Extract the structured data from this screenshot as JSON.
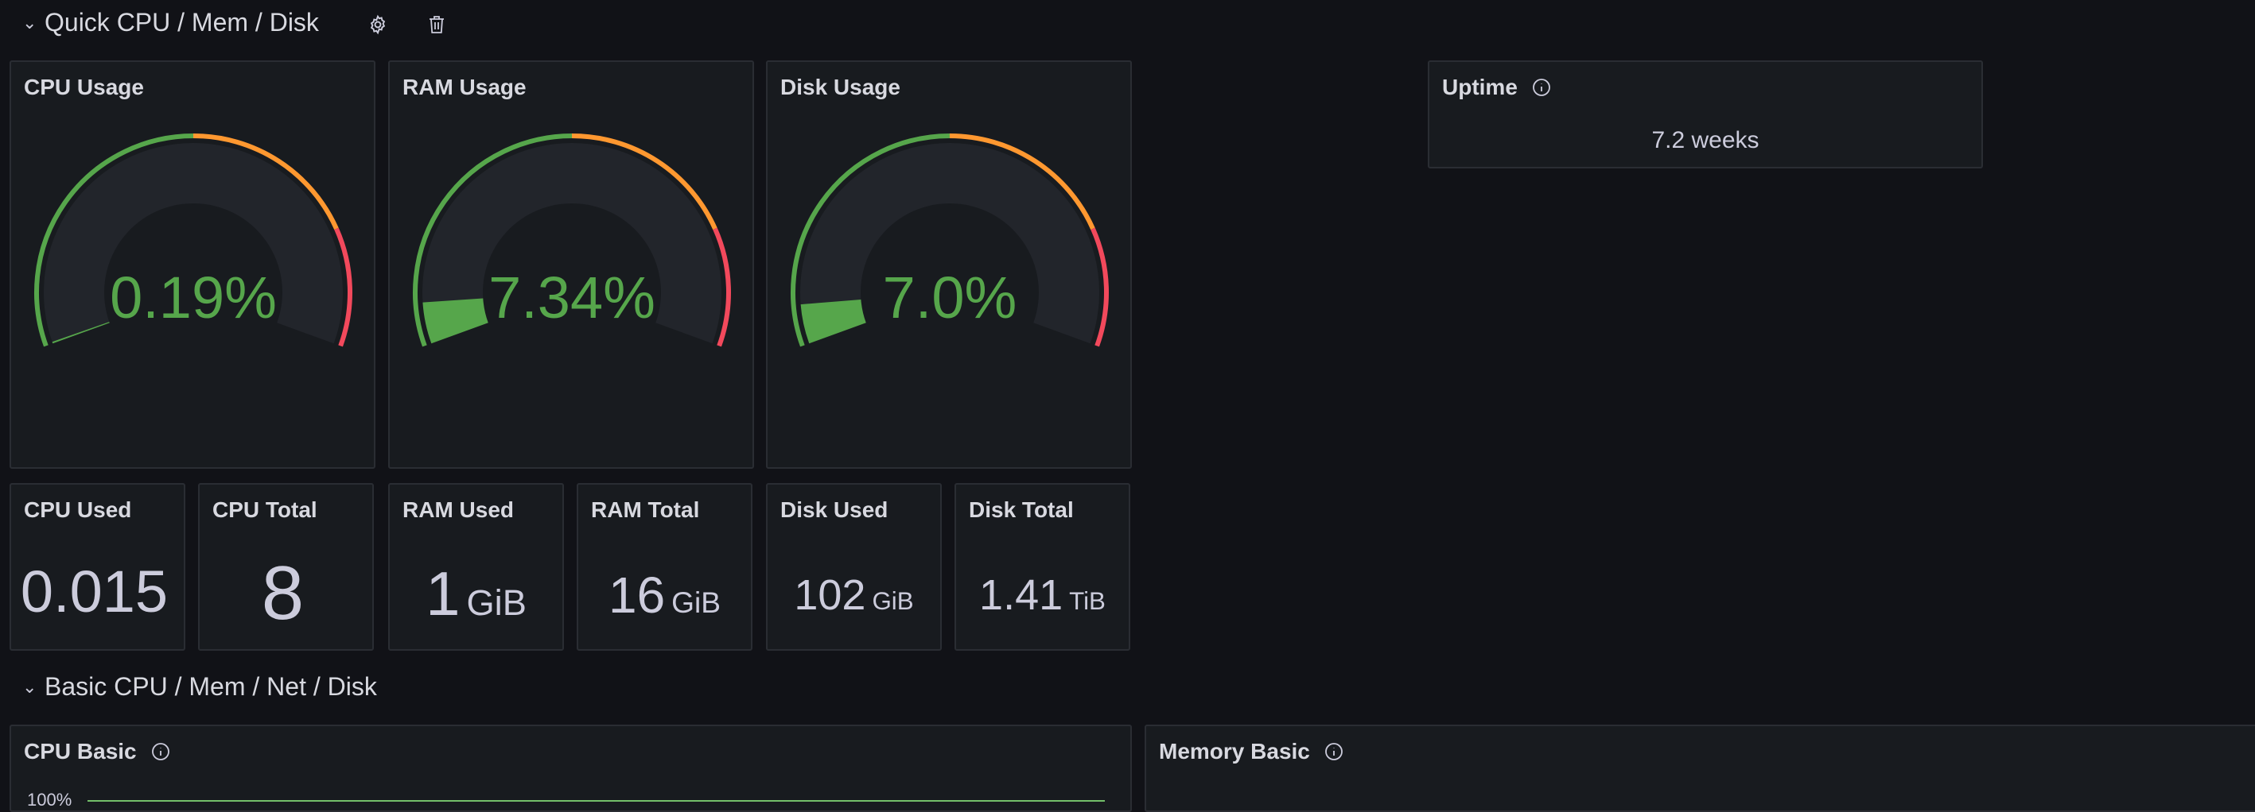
{
  "row1": {
    "title": "Quick CPU / Mem / Disk"
  },
  "row2": {
    "title": "Basic CPU / Mem / Net / Disk"
  },
  "colors": {
    "green": "#56a64b",
    "orange": "#ff9830",
    "red": "#f2495c",
    "track": "#22252b",
    "value": "#56a64b"
  },
  "gauges": [
    {
      "title": "CPU Usage",
      "display": "0.19%",
      "value": 0.19
    },
    {
      "title": "RAM Usage",
      "display": "7.34%",
      "value": 7.34
    },
    {
      "title": "Disk Usage",
      "display": "7.0%",
      "value": 7.0
    }
  ],
  "uptime": {
    "title": "Uptime",
    "value": "7.2 weeks"
  },
  "stats": [
    {
      "title": "CPU Used",
      "value": "0.015",
      "unit": ""
    },
    {
      "title": "CPU Total",
      "value": "8",
      "unit": ""
    },
    {
      "title": "RAM Used",
      "value": "1",
      "unit": "GiB"
    },
    {
      "title": "RAM Total",
      "value": "16",
      "unit": "GiB"
    },
    {
      "title": "Disk Used",
      "value": "102",
      "unit": "GiB"
    },
    {
      "title": "Disk Total",
      "value": "1.41",
      "unit": "TiB"
    }
  ],
  "cpu_basic": {
    "title": "CPU Basic",
    "axis_top": "100%"
  },
  "memory_basic": {
    "title": "Memory Basic"
  }
}
